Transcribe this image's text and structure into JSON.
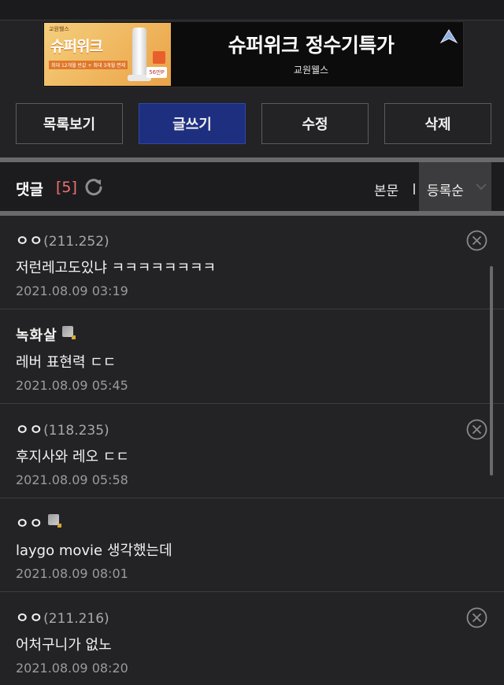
{
  "ad": {
    "title": "슈퍼위크 정수기특가",
    "subtitle": "교원웰스",
    "image": {
      "brand": "교원웰스",
      "product_name": "슈퍼위크",
      "promo": "최대 12개월 반값 + 최대 3개월 면제",
      "price": "56만P"
    }
  },
  "buttons": {
    "list": "목록보기",
    "write": "글쓰기",
    "edit": "수정",
    "delete": "삭제"
  },
  "comment_header": {
    "title": "댓글",
    "count": "[5]",
    "body_link": "본문",
    "sort": "등록순"
  },
  "comments": [
    {
      "author": "ㅇㅇ",
      "ip": "(211.252)",
      "text": "저런레고도있냐 ㅋㅋㅋㅋㅋㅋㅋㅋ",
      "date": "2021.08.09 03:19",
      "member": false
    },
    {
      "author": "녹화살",
      "ip": "",
      "text": "레버 표현력 ㄷㄷ",
      "date": "2021.08.09 05:45",
      "member": true
    },
    {
      "author": "ㅇㅇ",
      "ip": "(118.235)",
      "text": "후지사와 레오 ㄷㄷ",
      "date": "2021.08.09 05:58",
      "member": false
    },
    {
      "author": "ㅇㅇ",
      "ip": "",
      "text": "laygo movie 생각했는데",
      "date": "2021.08.09 08:01",
      "member": true
    },
    {
      "author": "ㅇㅇ",
      "ip": "(211.216)",
      "text": "어처구니가 없노",
      "date": "2021.08.09 08:20",
      "member": false
    }
  ],
  "colors": {
    "background": "#232325",
    "primary_button": "#1f2f80",
    "count_accent": "#f07070"
  }
}
